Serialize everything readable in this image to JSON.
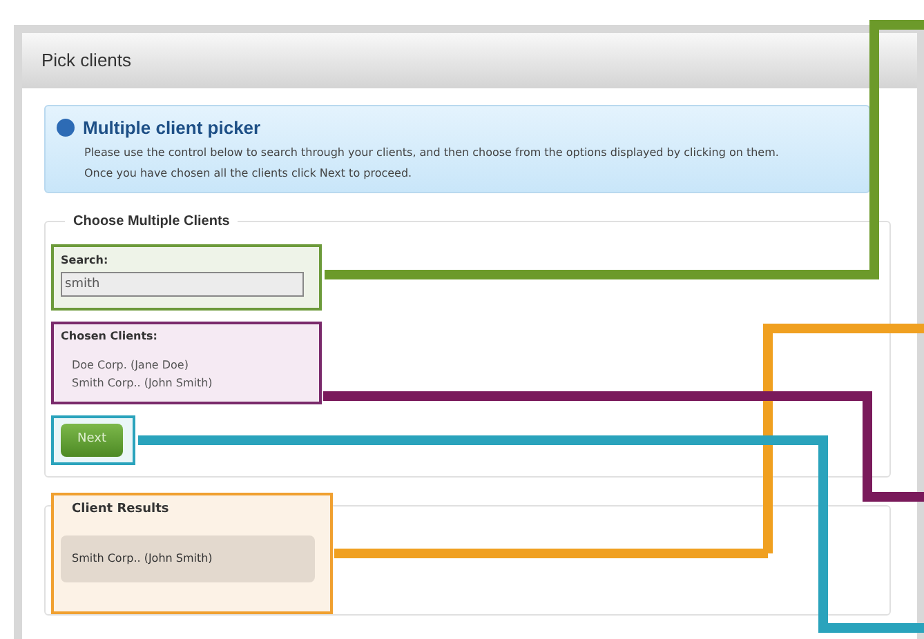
{
  "window": {
    "title": "Pick clients"
  },
  "info": {
    "title": "Multiple client picker",
    "lines": [
      "Please use the control below to search through your clients, and then choose from the options displayed by clicking on them.",
      "Once you have chosen all the clients click Next to proceed."
    ]
  },
  "chooser": {
    "legend": "Choose Multiple Clients",
    "search": {
      "label": "Search:",
      "value": "smith"
    },
    "chosen": {
      "label": "Chosen Clients:",
      "items": [
        "Doe Corp. (Jane Doe)",
        "Smith Corp.. (John Smith)"
      ]
    },
    "next_button": "Next"
  },
  "results": {
    "legend": "Client Results",
    "items": [
      "Smith Corp.. (John Smith)"
    ]
  }
}
